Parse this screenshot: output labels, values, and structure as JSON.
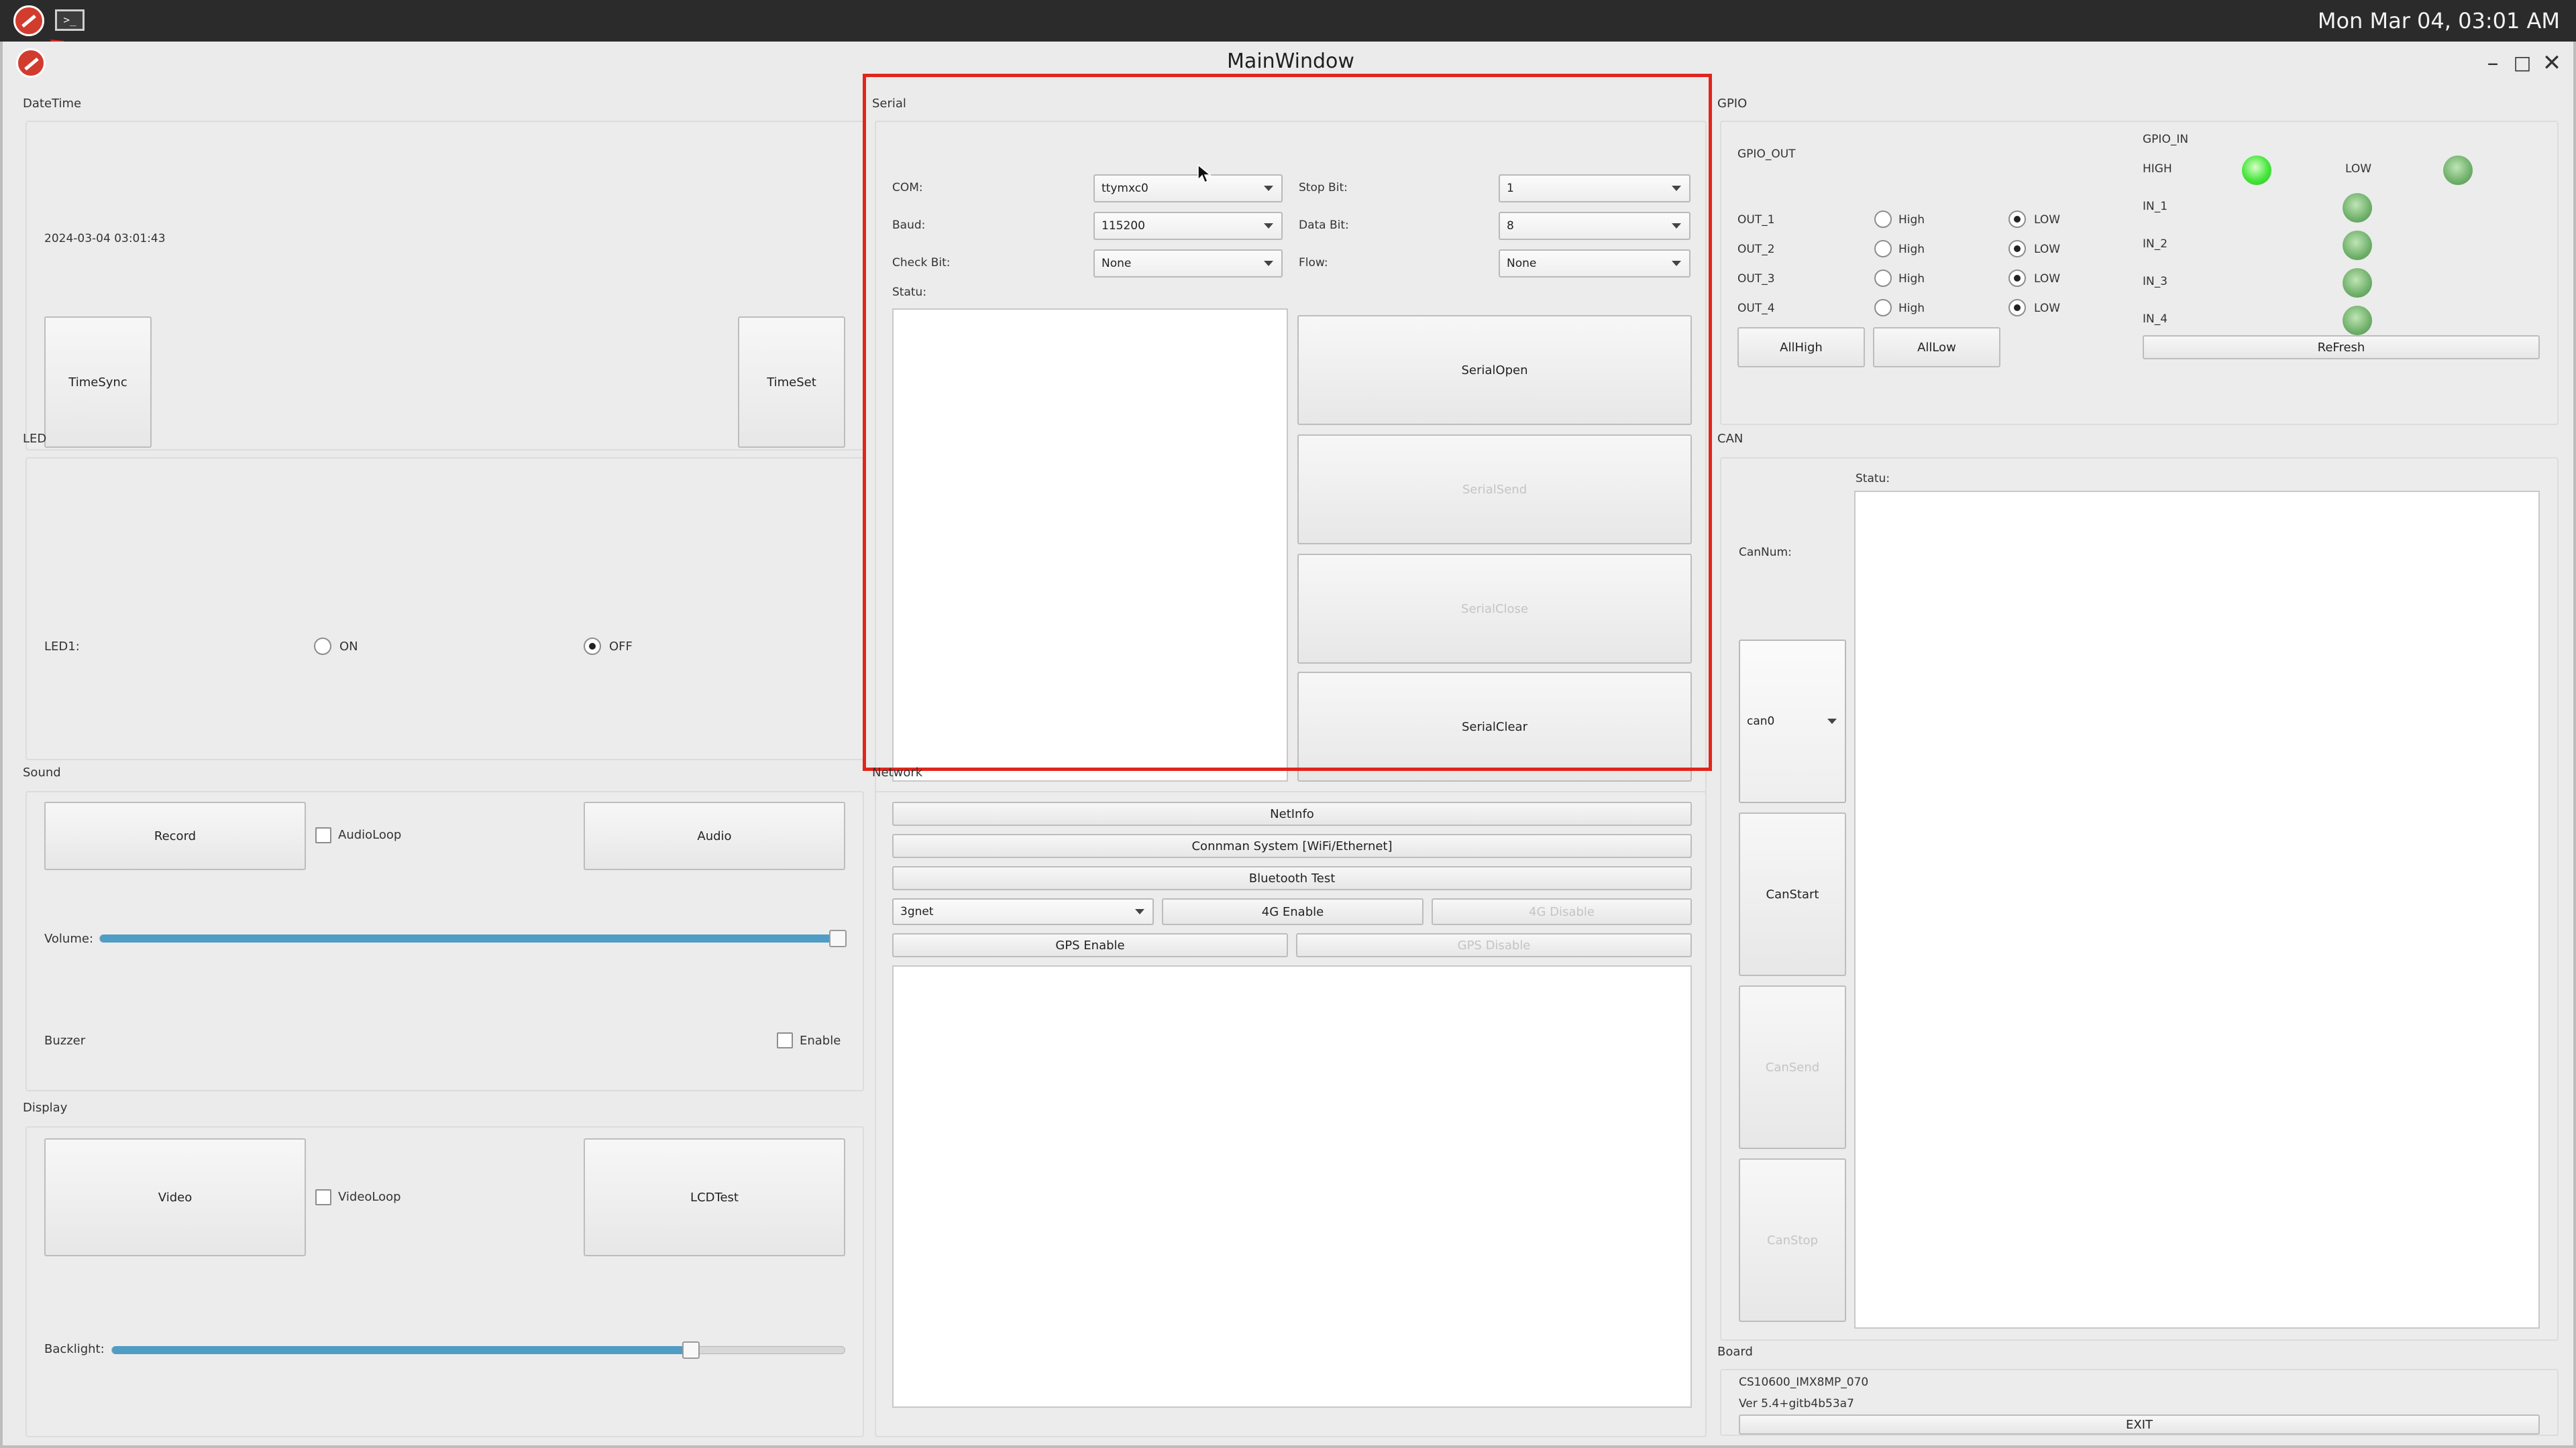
{
  "taskbar": {
    "clock": "Mon Mar 04, 03:01 AM",
    "terminal_icon": "terminal-icon"
  },
  "window": {
    "title": "MainWindow",
    "minimize": "–",
    "maximize": "□",
    "close": "✕"
  },
  "datetime": {
    "group": "DateTime",
    "value": "2024-03-04 03:01:43",
    "timesync": "TimeSync",
    "timeset": "TimeSet"
  },
  "led": {
    "group": "LED",
    "label": "LED1:",
    "on": "ON",
    "off": "OFF",
    "selected": "OFF"
  },
  "sound": {
    "group": "Sound",
    "record": "Record",
    "audioloop": "AudioLoop",
    "audio": "Audio",
    "volume_label": "Volume:",
    "volume_level": 0.99,
    "buzzer": "Buzzer",
    "enable": "Enable"
  },
  "display": {
    "group": "Display",
    "video": "Video",
    "videoloop": "VideoLoop",
    "lcdtest": "LCDTest",
    "backlight_label": "Backlight:",
    "backlight_level": 0.79
  },
  "serial": {
    "group": "Serial",
    "com_label": "COM:",
    "com_value": "ttymxc0",
    "stopbit_label": "Stop Bit:",
    "stopbit_value": "1",
    "baud_label": "Baud:",
    "baud_value": "115200",
    "databit_label": "Data Bit:",
    "databit_value": "8",
    "checkbit_label": "Check Bit:",
    "checkbit_value": "None",
    "flow_label": "Flow:",
    "flow_value": "None",
    "status_label": "Statu:",
    "open": "SerialOpen",
    "send": "SerialSend",
    "close": "SerialClose",
    "clear": "SerialClear"
  },
  "network": {
    "group": "Network",
    "netinfo": "NetInfo",
    "connman": "Connman System [WiFi/Ethernet]",
    "bluetooth": "Bluetooth Test",
    "apn_value": "3gnet",
    "enable4g": "4G Enable",
    "disable4g": "4G Disable",
    "gps_enable": "GPS Enable",
    "gps_disable": "GPS Disable"
  },
  "gpio": {
    "group": "GPIO",
    "out_group": "GPIO_OUT",
    "in_group": "GPIO_IN",
    "high_label": "HIGH",
    "low_label": "LOW",
    "outputs": [
      {
        "name": "OUT_1",
        "high": "High",
        "low": "LOW",
        "state": "LOW"
      },
      {
        "name": "OUT_2",
        "high": "High",
        "low": "LOW",
        "state": "LOW"
      },
      {
        "name": "OUT_3",
        "high": "High",
        "low": "LOW",
        "state": "LOW"
      },
      {
        "name": "OUT_4",
        "high": "High",
        "low": "LOW",
        "state": "LOW"
      }
    ],
    "inputs": [
      "IN_1",
      "IN_2",
      "IN_3",
      "IN_4"
    ],
    "allhigh": "AllHigh",
    "alllow": "AllLow",
    "refresh": "ReFresh",
    "led_colors": {
      "high": "#46e63c",
      "low": "#6fb06a"
    }
  },
  "can": {
    "group": "CAN",
    "status_label": "Statu:",
    "cannum_label": "CanNum:",
    "cannum_value": "can0",
    "start": "CanStart",
    "send": "CanSend",
    "stop": "CanStop"
  },
  "board": {
    "group": "Board",
    "model": "CS10600_IMX8MP_070",
    "version": "Ver 5.4+gitb4b53a7",
    "exit": "EXIT"
  },
  "annotation": {
    "highlight_color": "#e0261c"
  }
}
